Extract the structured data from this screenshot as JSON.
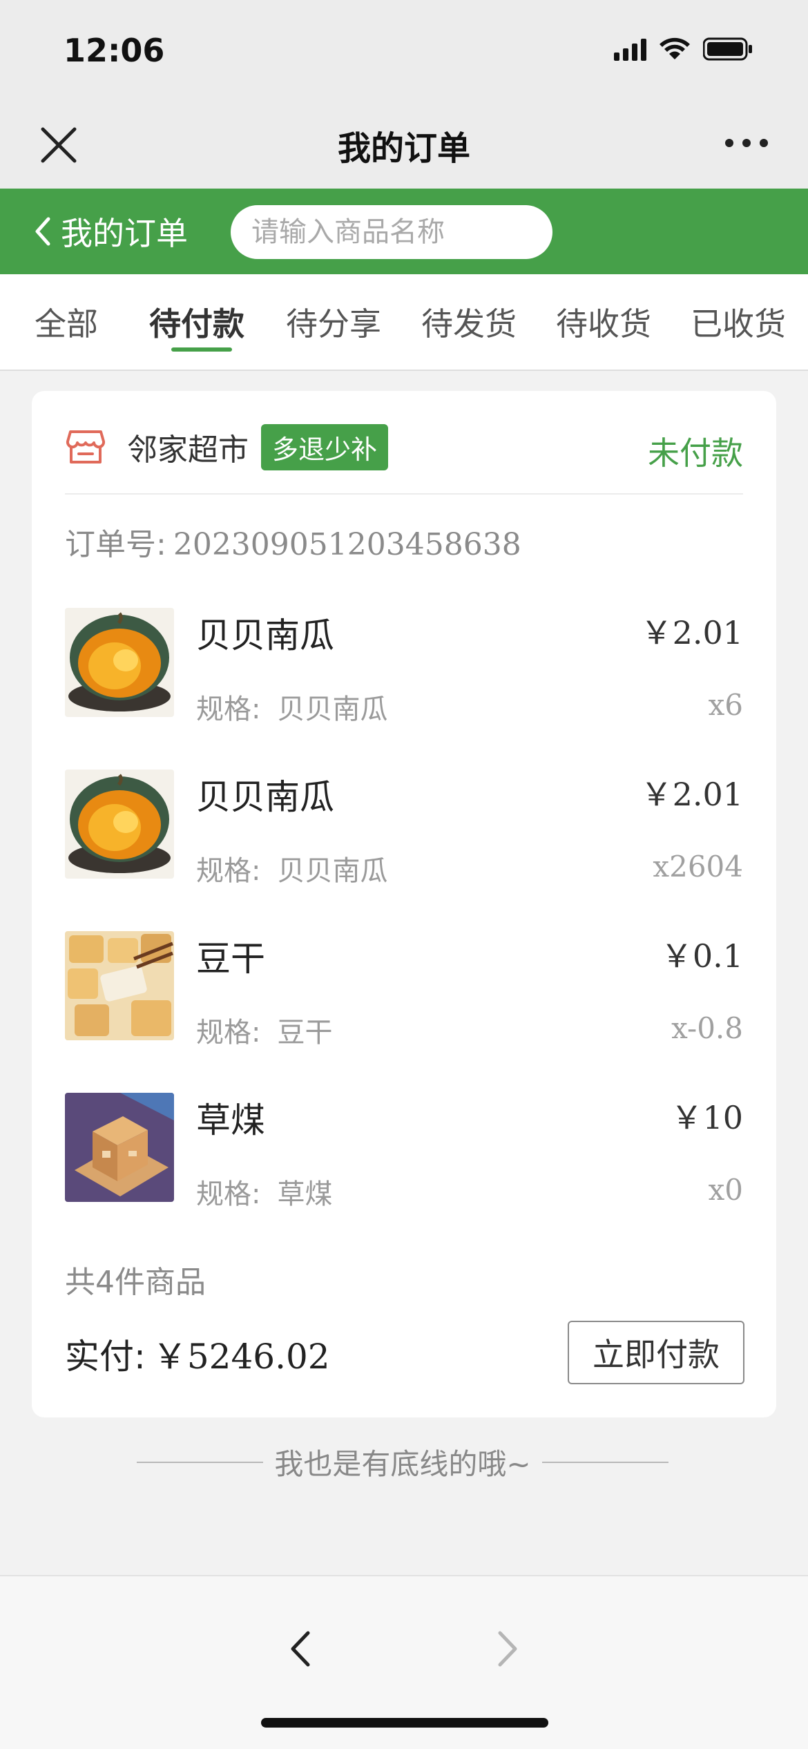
{
  "status_bar": {
    "time": "12:06"
  },
  "wechat_bar": {
    "title": "我的订单"
  },
  "header": {
    "back_label": "我的订单",
    "search_placeholder": "请输入商品名称"
  },
  "tabs": [
    {
      "label": "全部"
    },
    {
      "label": "待付款"
    },
    {
      "label": "待分享"
    },
    {
      "label": "待发货"
    },
    {
      "label": "待收货"
    },
    {
      "label": "已收货"
    }
  ],
  "active_tab": "待付款",
  "colors": {
    "brand_green": "#46a049",
    "store_icon_red": "#e06a5a"
  },
  "order": {
    "store_name": "邻家超市",
    "badge": "多退少补",
    "status": "未付款",
    "order_no_label": "订单号:",
    "order_no": "20230905120345863 8",
    "items": [
      {
        "name": "贝贝南瓜",
        "spec_label": "规格:",
        "spec": "贝贝南瓜",
        "price": "￥2.01",
        "qty": "x6",
        "image": "pumpkin"
      },
      {
        "name": "贝贝南瓜",
        "spec_label": "规格:",
        "spec": "贝贝南瓜",
        "price": "￥2.01",
        "qty": "x2604",
        "image": "pumpkin"
      },
      {
        "name": "豆干",
        "spec_label": "规格:",
        "spec": "豆干",
        "price": "￥0.1",
        "qty": "x-0.8",
        "image": "tofu"
      },
      {
        "name": "草煤",
        "spec_label": "规格:",
        "spec": "草煤",
        "price": "￥10",
        "qty": "x0",
        "image": "box"
      }
    ],
    "total_count": "共4件商品",
    "paid_label": "实付:",
    "paid_amount": "￥5246.02",
    "pay_button": "立即付款"
  },
  "footer_text": "我也是有底线的哦~"
}
